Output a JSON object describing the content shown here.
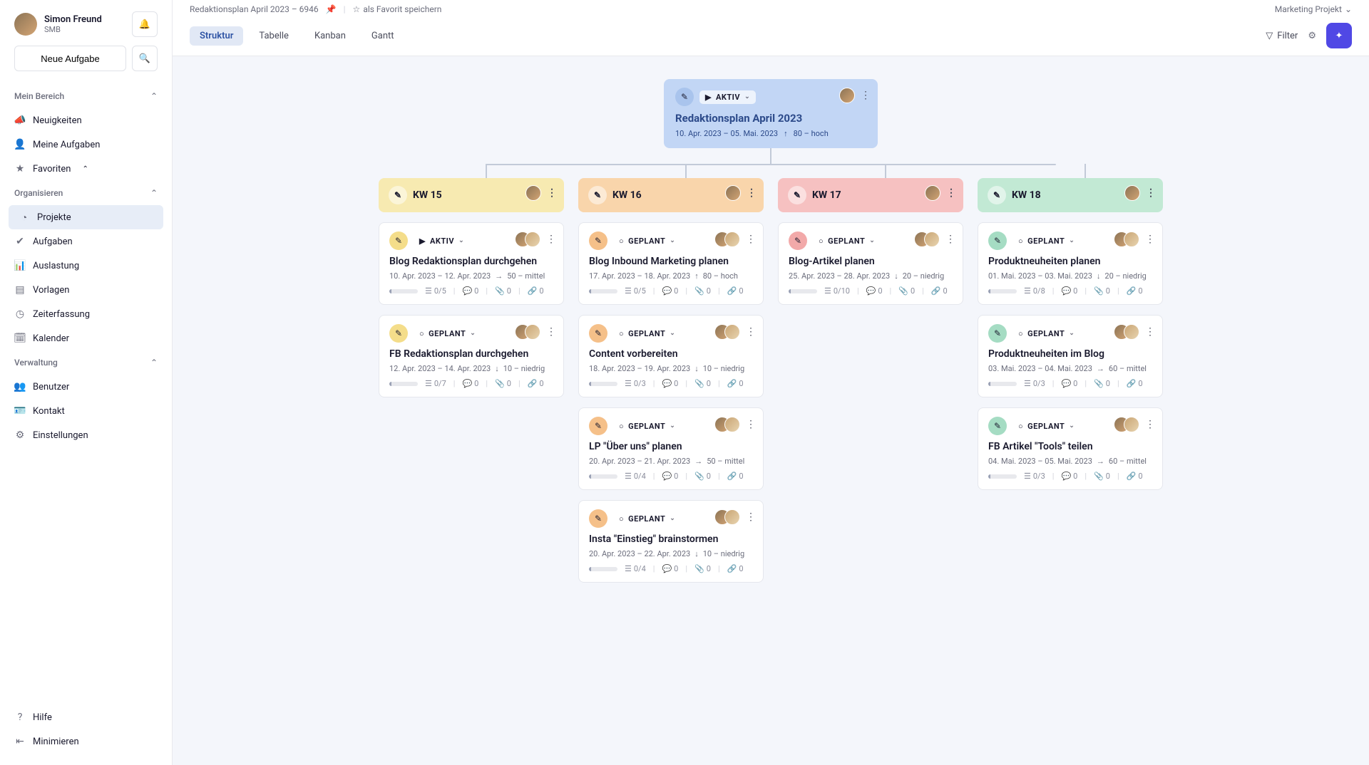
{
  "user": {
    "name": "Simon Freund",
    "sub": "SMB"
  },
  "sidebar": {
    "newTask": "Neue Aufgabe",
    "section_mybereich": "Mein Bereich",
    "nav_neuigkeiten": "Neuigkeiten",
    "nav_meineaufgaben": "Meine Aufgaben",
    "nav_favoriten": "Favoriten",
    "section_organisieren": "Organisieren",
    "nav_projekte": "Projekte",
    "nav_aufgaben": "Aufgaben",
    "nav_auslastung": "Auslastung",
    "nav_vorlagen": "Vorlagen",
    "nav_zeiterfassung": "Zeiterfassung",
    "nav_kalender": "Kalender",
    "section_verwaltung": "Verwaltung",
    "nav_benutzer": "Benutzer",
    "nav_kontakt": "Kontakt",
    "nav_einstellungen": "Einstellungen",
    "nav_hilfe": "Hilfe",
    "nav_minimieren": "Minimieren"
  },
  "breadcrumb": {
    "project": "Redaktionsplan April 2023 – 6946",
    "fav": "als Favorit speichern",
    "marketing": "Marketing Projekt"
  },
  "tabs": {
    "struktur": "Struktur",
    "tabelle": "Tabelle",
    "kanban": "Kanban",
    "gantt": "Gantt"
  },
  "toolbar": {
    "filter": "Filter"
  },
  "root": {
    "status": "AKTIV",
    "title": "Redaktionsplan April 2023",
    "dates": "10. Apr. 2023 – 05. Mai. 2023",
    "priority": "80 – hoch"
  },
  "lanes": {
    "kw15": {
      "title": "KW 15",
      "tasks": [
        {
          "status": "AKTIV",
          "title": "Blog Redaktionsplan durchgehen",
          "dates": "10. Apr. 2023 – 12. Apr. 2023",
          "pri": "50 – mittel",
          "sub": "0/5",
          "c": "0",
          "a": "0",
          "l": "0"
        },
        {
          "status": "GEPLANT",
          "title": "FB Redaktionsplan durchgehen",
          "dates": "12. Apr. 2023 – 14. Apr. 2023",
          "pri": "10 – niedrig",
          "sub": "0/7",
          "c": "0",
          "a": "0",
          "l": "0"
        }
      ]
    },
    "kw16": {
      "title": "KW 16",
      "tasks": [
        {
          "status": "GEPLANT",
          "title": "Blog Inbound Marketing planen",
          "dates": "17. Apr. 2023 – 18. Apr. 2023",
          "pri": "80 – hoch",
          "sub": "0/5",
          "c": "0",
          "a": "0",
          "l": "0"
        },
        {
          "status": "GEPLANT",
          "title": "Content vorbereiten",
          "dates": "18. Apr. 2023 – 19. Apr. 2023",
          "pri": "10 – niedrig",
          "sub": "0/3",
          "c": "0",
          "a": "0",
          "l": "0"
        },
        {
          "status": "GEPLANT",
          "title": "LP \"Über uns\" planen",
          "dates": "20. Apr. 2023 – 21. Apr. 2023",
          "pri": "50 – mittel",
          "sub": "0/4",
          "c": "0",
          "a": "0",
          "l": "0"
        },
        {
          "status": "GEPLANT",
          "title": "Insta \"Einstieg\" brainstormen",
          "dates": "20. Apr. 2023 – 22. Apr. 2023",
          "pri": "10 – niedrig",
          "sub": "0/4",
          "c": "0",
          "a": "0",
          "l": "0"
        }
      ]
    },
    "kw17": {
      "title": "KW 17",
      "tasks": [
        {
          "status": "GEPLANT",
          "title": "Blog-Artikel planen",
          "dates": "25. Apr. 2023 – 28. Apr. 2023",
          "pri": "20 – niedrig",
          "sub": "0/10",
          "c": "0",
          "a": "0",
          "l": "0"
        }
      ]
    },
    "kw18": {
      "title": "KW 18",
      "tasks": [
        {
          "status": "GEPLANT",
          "title": "Produktneuheiten planen",
          "dates": "01. Mai. 2023 – 03. Mai. 2023",
          "pri": "20 – niedrig",
          "sub": "0/8",
          "c": "0",
          "a": "0",
          "l": "0"
        },
        {
          "status": "GEPLANT",
          "title": "Produktneuheiten im Blog",
          "dates": "03. Mai. 2023 – 04. Mai. 2023",
          "pri": "60 – mittel",
          "sub": "0/3",
          "c": "0",
          "a": "0",
          "l": "0"
        },
        {
          "status": "GEPLANT",
          "title": "FB Artikel \"Tools\" teilen",
          "dates": "04. Mai. 2023 – 05. Mai. 2023",
          "pri": "60 – mittel",
          "sub": "0/3",
          "c": "0",
          "a": "0",
          "l": "0"
        }
      ]
    }
  }
}
